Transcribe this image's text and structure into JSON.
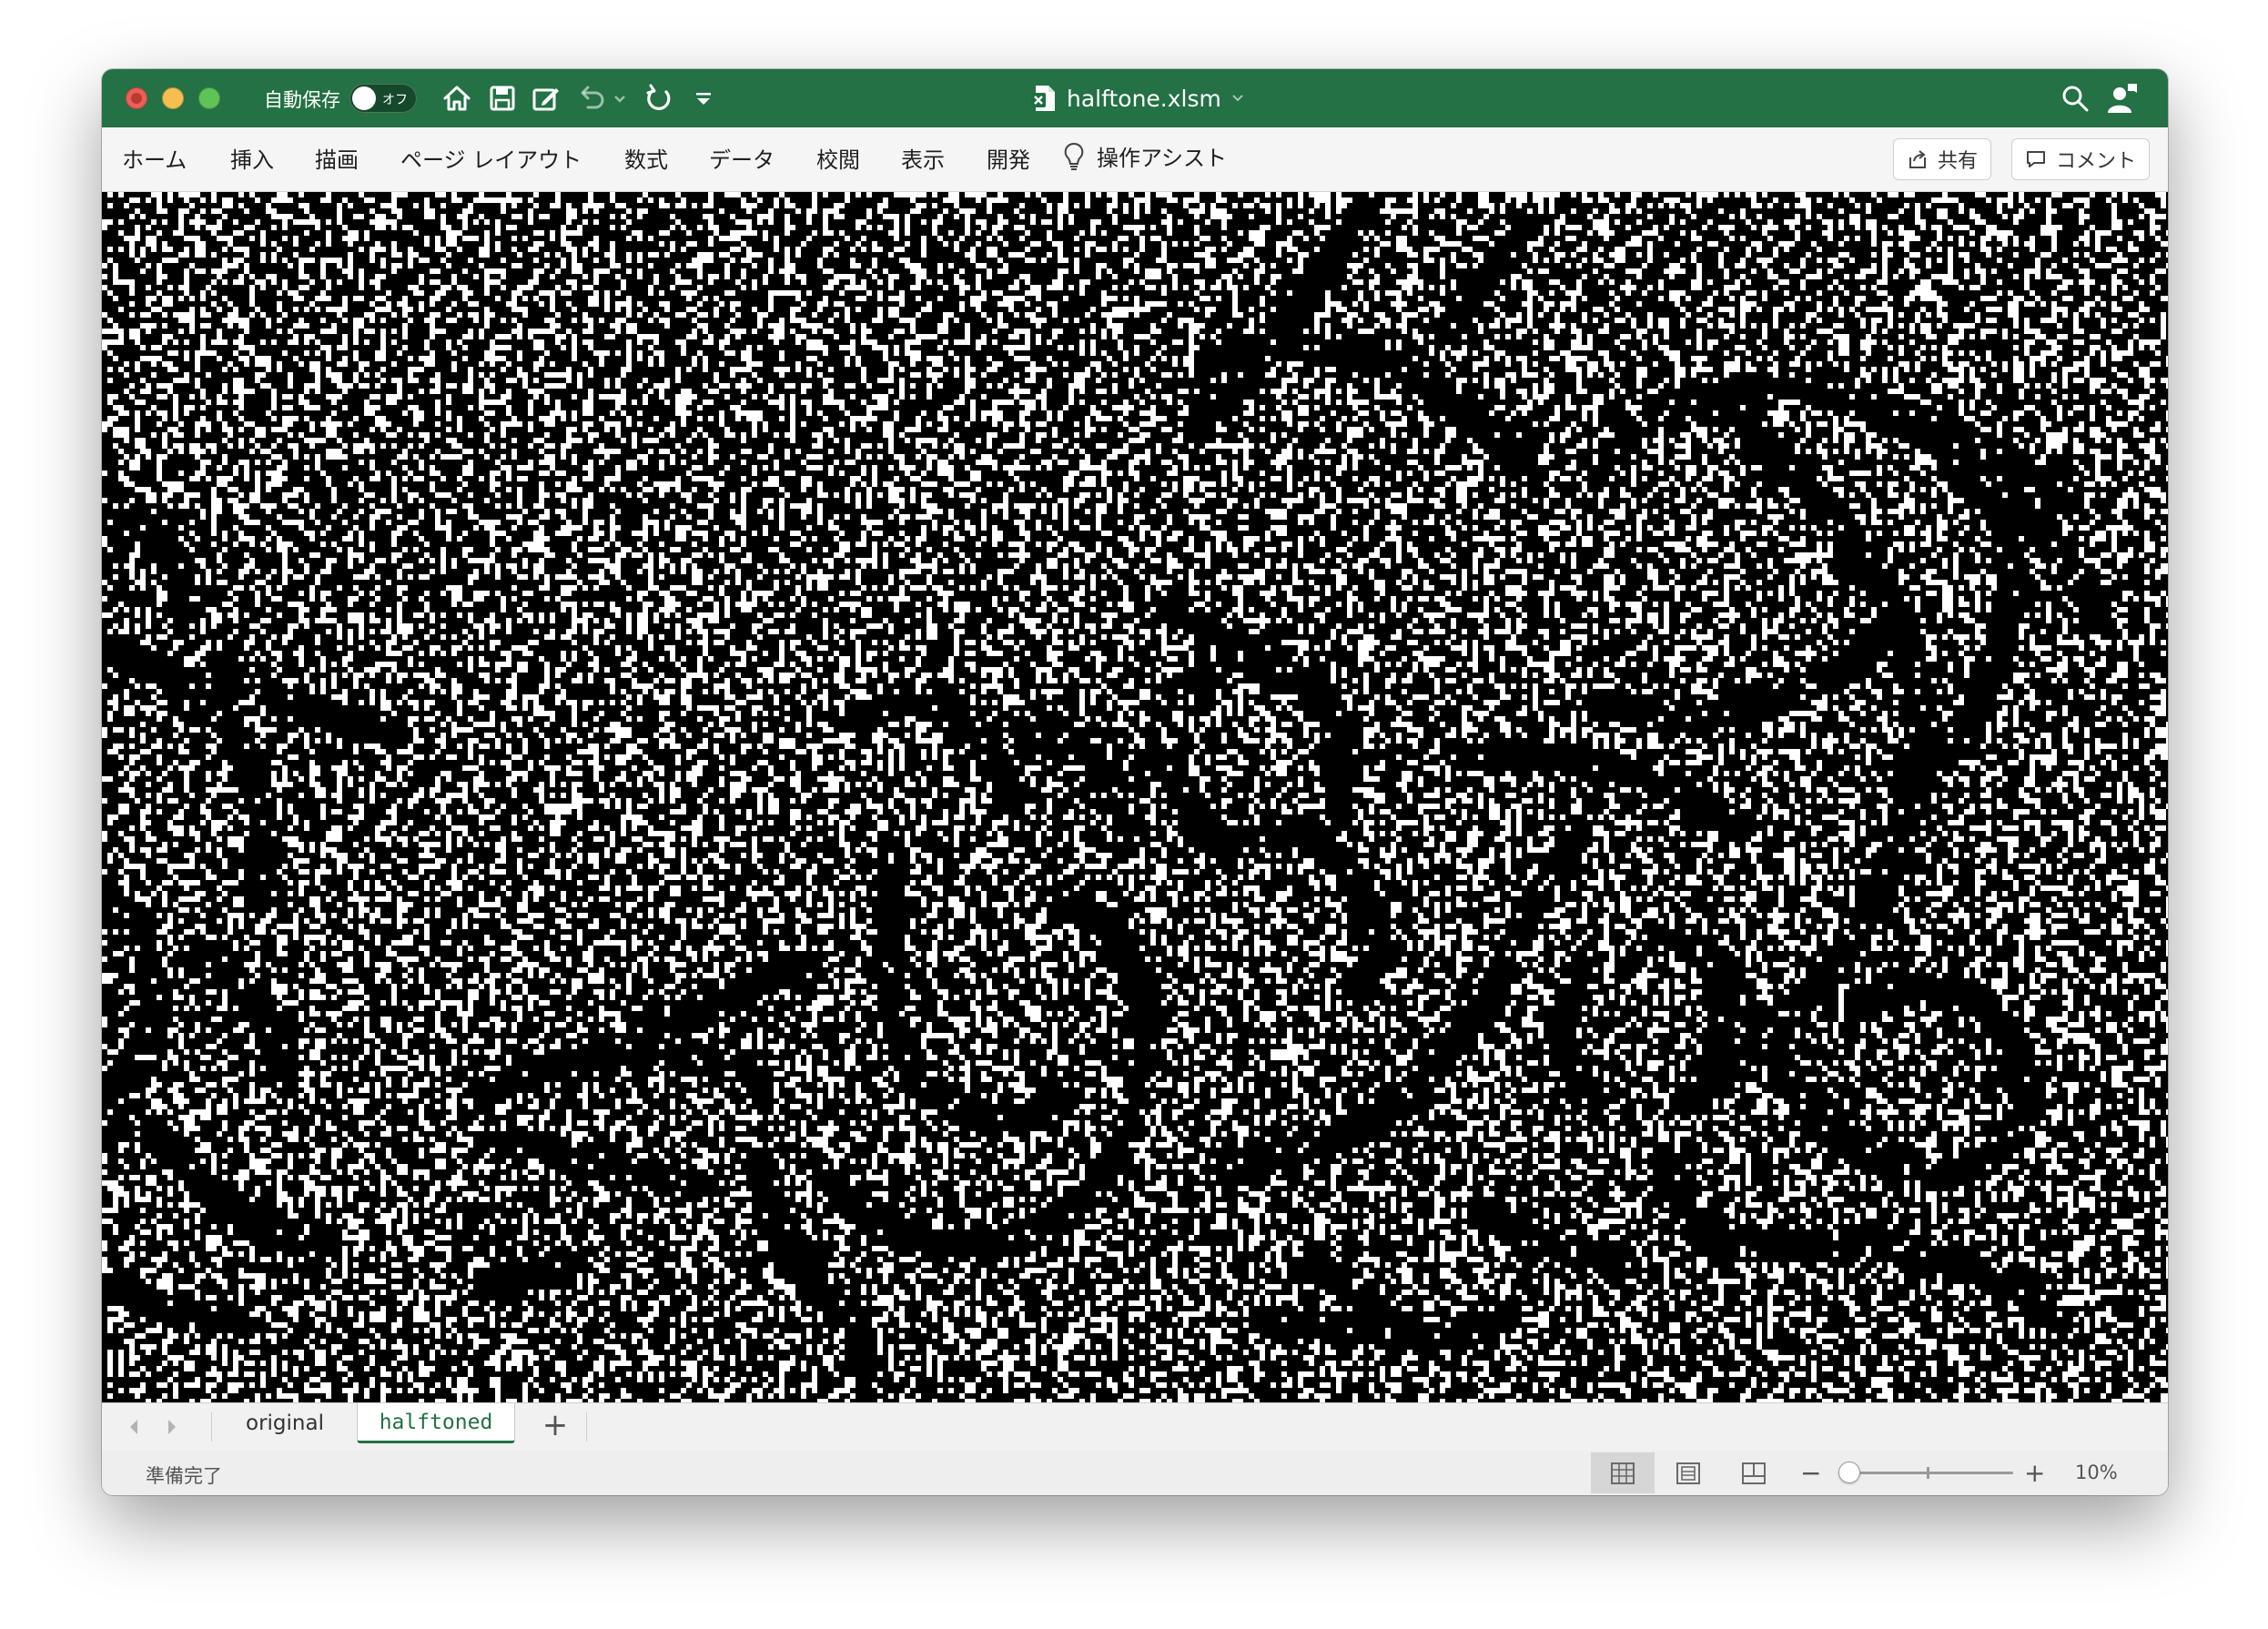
{
  "window": {
    "file_name": "halftone.xlsm"
  },
  "titlebar": {
    "autosave_label": "自動保存",
    "autosave_state": "オフ",
    "icons": [
      "home-icon",
      "save-icon",
      "edit-save-icon",
      "undo-icon",
      "redo-icon",
      "customize-toolbar-icon",
      "search-icon",
      "people-icon"
    ]
  },
  "ribbon": {
    "tabs": [
      "ホーム",
      "挿入",
      "描画",
      "ページ レイアウト",
      "数式",
      "データ",
      "校閲",
      "表示",
      "開発"
    ],
    "tell_me": "操作アシスト",
    "share": "共有",
    "comment": "コメント"
  },
  "sheet_tabs": {
    "items": [
      "original",
      "halftoned"
    ],
    "active": "halftoned"
  },
  "statusbar": {
    "status": "準備完了",
    "zoom": "10%"
  },
  "colors": {
    "titlebar": "#237144",
    "active_tab": "#237144"
  }
}
